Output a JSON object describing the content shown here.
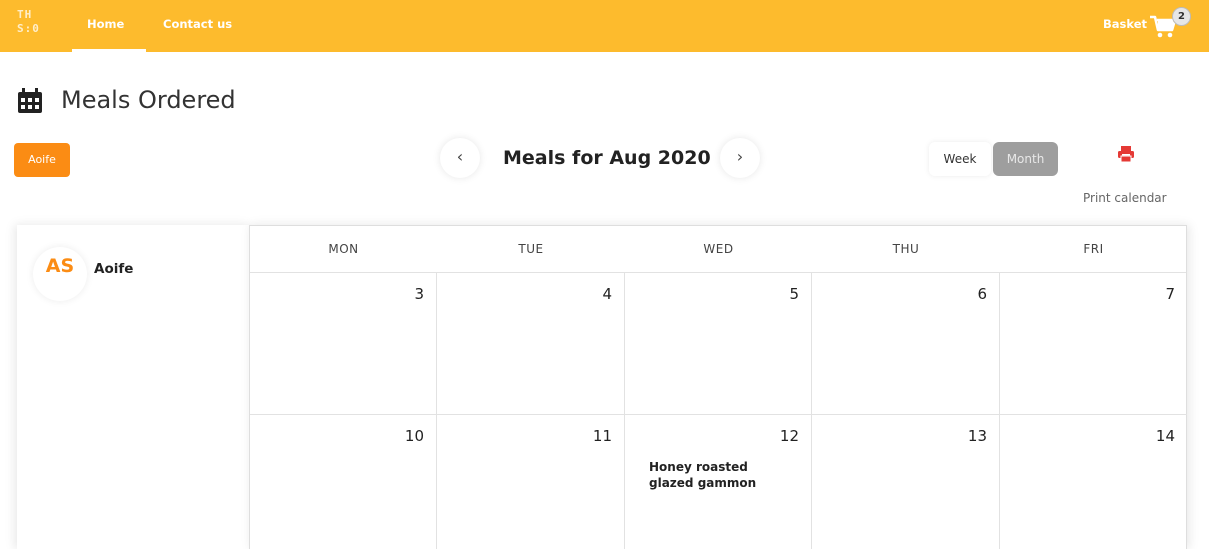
{
  "header": {
    "logo_text": "TH\nS:0",
    "nav": [
      {
        "label": "Home"
      },
      {
        "label": "Contact us"
      }
    ],
    "basket_label": "Basket",
    "basket_count": "2",
    "bar_color": "#fdbb2d"
  },
  "page": {
    "title": "Meals Ordered",
    "title_icon": "calendar-icon"
  },
  "controls": {
    "user_button": "Aoife",
    "month_title": "Meals for Aug 2020",
    "prev_icon": "chevron-left-icon",
    "next_icon": "chevron-right-icon",
    "prev_glyph": "‹",
    "next_glyph": "›",
    "week_label": "Week",
    "month_label": "Month",
    "print_icon": "printer-icon",
    "print_label": "Print calendar",
    "accent_color": "#fb8c14"
  },
  "sidebar": {
    "initials": "AS",
    "name": "Aoife"
  },
  "calendar": {
    "days": [
      "MON",
      "TUE",
      "WED",
      "THU",
      "FRI"
    ],
    "weeks": [
      [
        {
          "date": "3",
          "meal": ""
        },
        {
          "date": "4",
          "meal": ""
        },
        {
          "date": "5",
          "meal": ""
        },
        {
          "date": "6",
          "meal": ""
        },
        {
          "date": "7",
          "meal": ""
        }
      ],
      [
        {
          "date": "10",
          "meal": ""
        },
        {
          "date": "11",
          "meal": ""
        },
        {
          "date": "12",
          "meal": "Honey roasted glazed gammon"
        },
        {
          "date": "13",
          "meal": ""
        },
        {
          "date": "14",
          "meal": ""
        }
      ]
    ]
  }
}
